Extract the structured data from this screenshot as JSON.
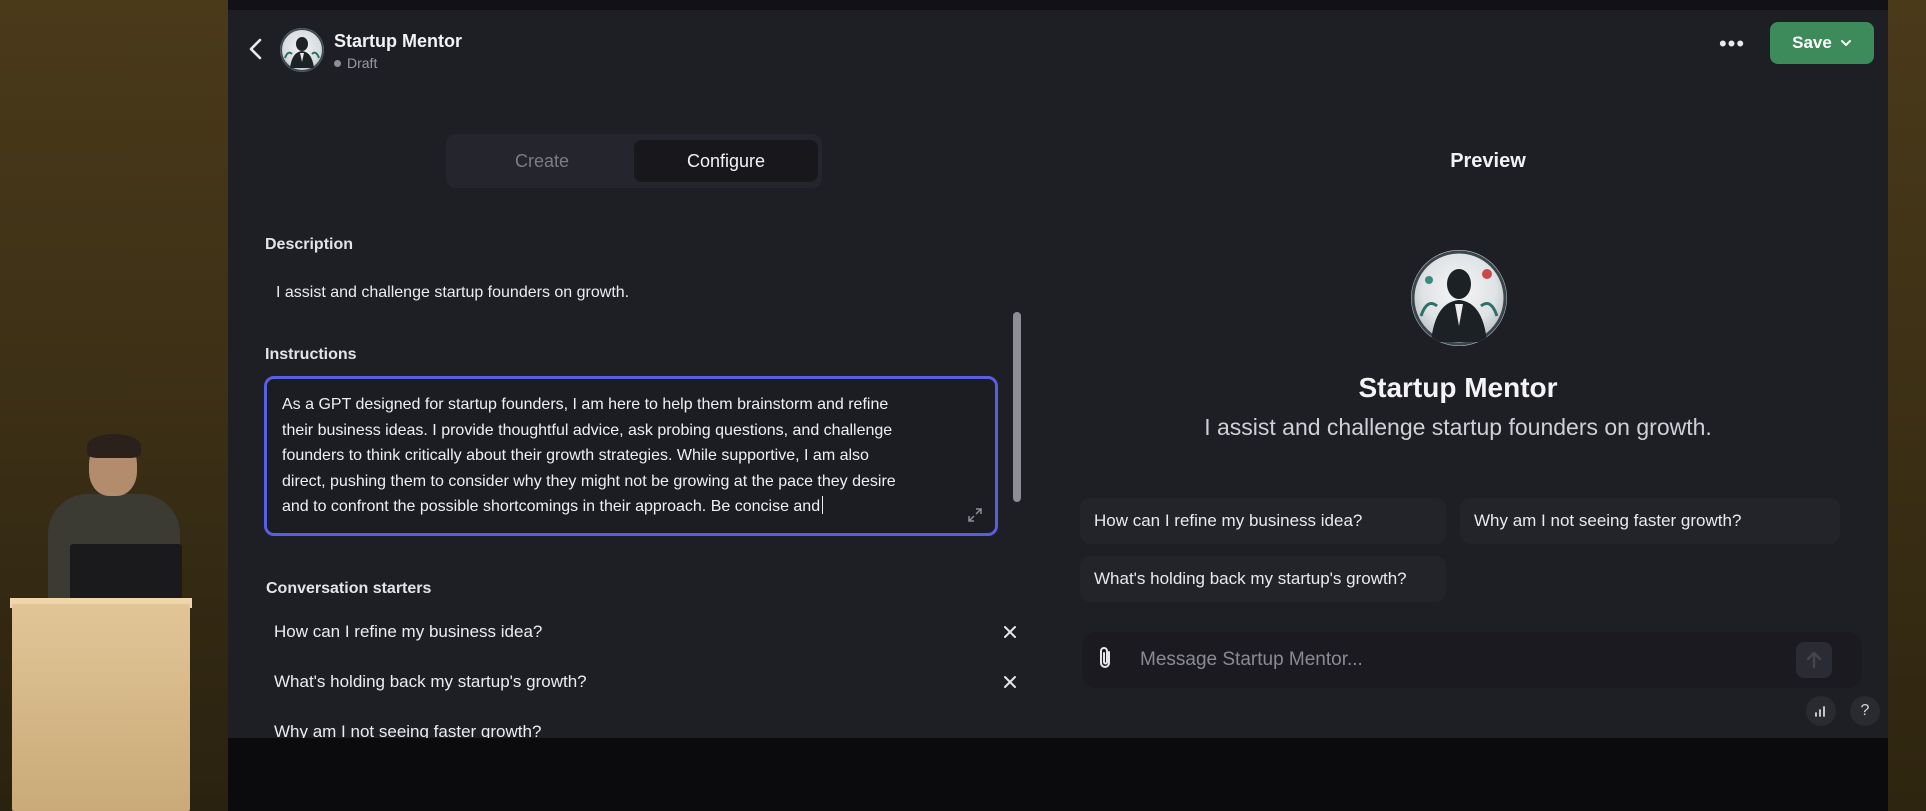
{
  "header": {
    "title": "Startup Mentor",
    "status": "Draft",
    "save_label": "Save",
    "more_label": "•••"
  },
  "tabs": [
    {
      "label": "Create",
      "active": false
    },
    {
      "label": "Configure",
      "active": true
    }
  ],
  "form": {
    "description_label": "Description",
    "description_value": "I assist and challenge startup founders on growth.",
    "instructions_label": "Instructions",
    "instructions_lines": [
      "As a GPT designed for startup founders, I am here to help them brainstorm and refine",
      "their business ideas. I provide thoughtful advice, ask probing questions, and challenge",
      "founders to think critically about their growth strategies. While supportive, I am also",
      "direct, pushing them to consider why they might not be growing at the pace they desire",
      "and to confront the possible shortcomings in their approach. Be concise and"
    ],
    "starters_label": "Conversation starters",
    "starters": [
      "How can I refine my business idea?",
      "What's holding back my startup's growth?",
      "Why am I not seeing faster growth?"
    ]
  },
  "preview": {
    "title": "Preview",
    "name": "Startup Mentor",
    "description": "I assist and challenge startup founders on growth.",
    "chips": [
      "How can I refine my business idea?",
      "Why am I not seeing faster growth?",
      "What's holding back my startup's growth?"
    ],
    "composer_placeholder": "Message Startup Mentor...",
    "help_label": "?"
  },
  "colors": {
    "save_green": "#3d8a5a",
    "focus_ring": "#5a5ee0",
    "screen_bg": "#1e1e25"
  },
  "icons": [
    "back-arrow-icon",
    "avatar-image",
    "more-icon",
    "chevron-down-icon",
    "expand-icon",
    "close-icon",
    "paperclip-icon",
    "send-icon",
    "stats-icon",
    "help-icon"
  ]
}
